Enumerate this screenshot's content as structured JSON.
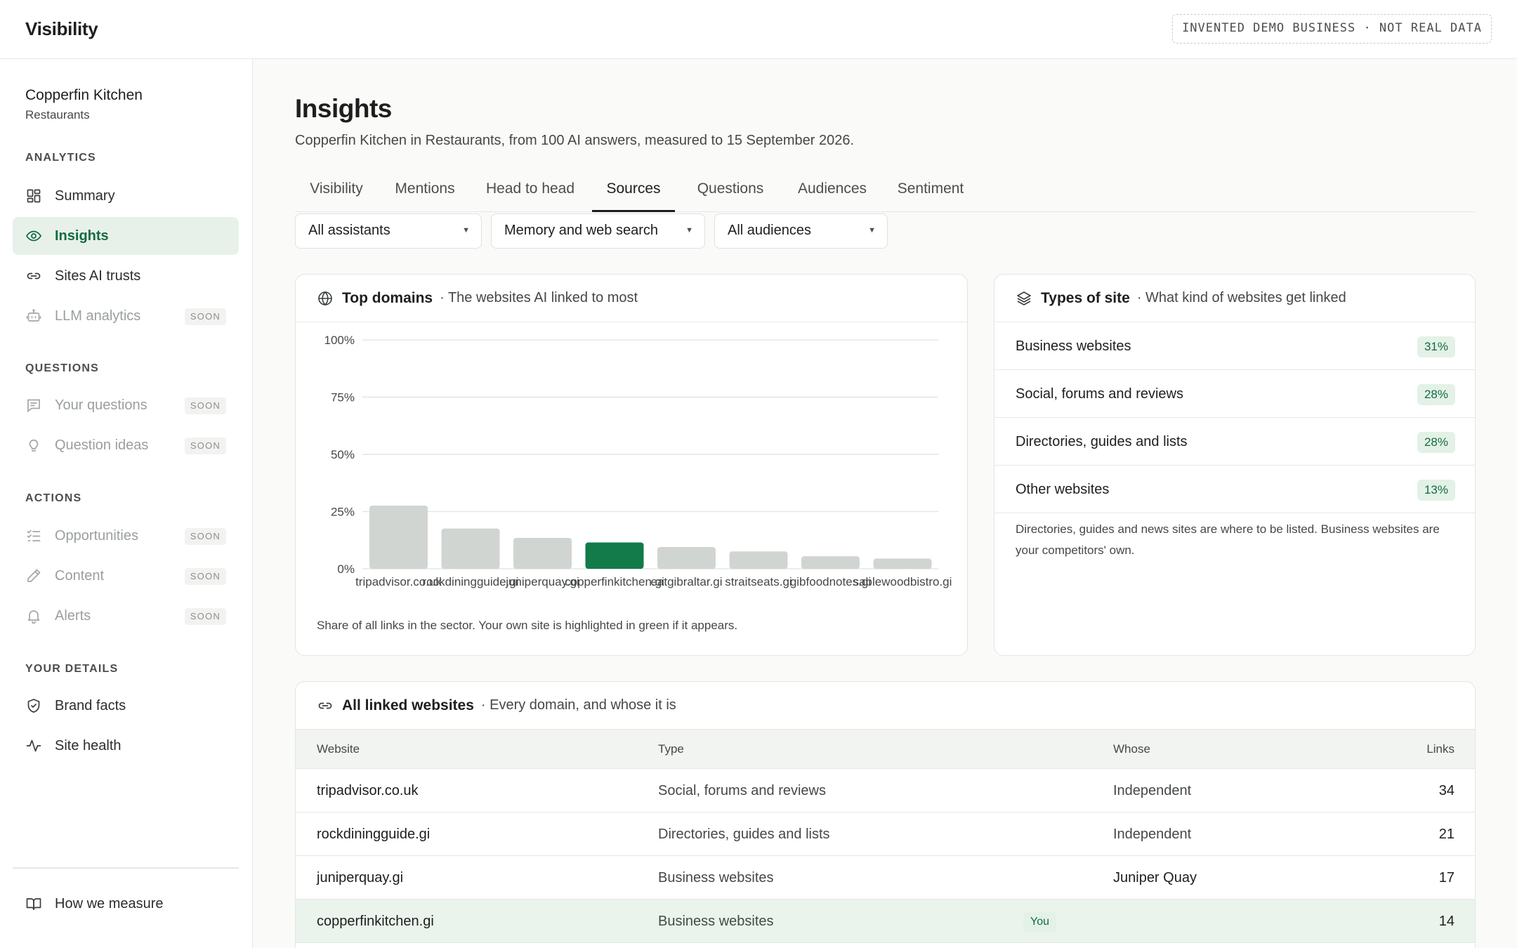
{
  "app": {
    "title": "Visibility",
    "demo_badge": "INVENTED DEMO BUSINESS · NOT REAL DATA"
  },
  "sidebar": {
    "business_name": "Copperfin Kitchen",
    "business_sector": "Restaurants",
    "soon_label": "SOON",
    "sections": {
      "analytics": "ANALYTICS",
      "questions": "QUESTIONS",
      "actions": "ACTIONS",
      "details": "YOUR DETAILS"
    },
    "items": {
      "summary": "Summary",
      "insights": "Insights",
      "sites_ai_trusts": "Sites AI trusts",
      "llm_analytics": "LLM analytics",
      "your_questions": "Your questions",
      "question_ideas": "Question ideas",
      "opportunities": "Opportunities",
      "content": "Content",
      "alerts": "Alerts",
      "brand_facts": "Brand facts",
      "site_health": "Site health",
      "how_we_measure": "How we measure"
    }
  },
  "page": {
    "title": "Insights",
    "subtitle": "Copperfin Kitchen in Restaurants, from 100 AI answers, measured to 15 September 2026."
  },
  "tabs": [
    "Visibility",
    "Mentions",
    "Head to head",
    "Sources",
    "Questions",
    "Audiences",
    "Sentiment"
  ],
  "active_tab": "Sources",
  "filters": {
    "assistant": "All assistants",
    "mode": "Memory and web search",
    "audience": "All audiences"
  },
  "top_domains": {
    "title": "Top domains",
    "subtitle": "The websites AI linked to most",
    "note": "Share of all links in the sector. Your own site is highlighted in green if it appears."
  },
  "chart_data": {
    "type": "bar",
    "categories": [
      "tripadvisor.co.uk",
      "rockdiningguide.gi",
      "juniperquay.gi",
      "copperfinkitchen.gi",
      "eatgibraltar.gi",
      "straitseats.gi",
      "gibfoodnotes.gi",
      "sablewoodbistro.gi"
    ],
    "values": [
      27.6,
      17.6,
      13.5,
      11.5,
      9.5,
      7.6,
      5.5,
      4.5
    ],
    "highlight_index": 3,
    "y_ticks": [
      "0%",
      "25%",
      "50%",
      "75%",
      "100%"
    ],
    "ylim": [
      0,
      100
    ],
    "grid": true,
    "colors": {
      "bar": "#d1d5d1",
      "highlight": "#137a4a"
    }
  },
  "types_of_site": {
    "title": "Types of site",
    "subtitle": "What kind of websites get linked",
    "rows": [
      {
        "label": "Business websites",
        "pct": "31%"
      },
      {
        "label": "Social, forums and reviews",
        "pct": "28%"
      },
      {
        "label": "Directories, guides and lists",
        "pct": "28%"
      },
      {
        "label": "Other websites",
        "pct": "13%"
      }
    ],
    "note": "Directories, guides and news sites are where to be listed. Business websites are your competitors' own."
  },
  "linked_websites": {
    "title": "All linked websites",
    "subtitle": "Every domain, and whose it is",
    "columns": {
      "website": "Website",
      "type": "Type",
      "whose": "Whose",
      "links": "Links"
    },
    "rows": [
      {
        "website": "tripadvisor.co.uk",
        "type": "Social, forums and reviews",
        "whose": "Independent",
        "links": "34"
      },
      {
        "website": "rockdiningguide.gi",
        "type": "Directories, guides and lists",
        "whose": "Independent",
        "links": "21"
      },
      {
        "website": "juniperquay.gi",
        "type": "Business websites",
        "whose": "Juniper Quay",
        "links": "17"
      },
      {
        "website": "copperfinkitchen.gi",
        "type": "Business websites",
        "whose": "You",
        "links": "14"
      }
    ]
  }
}
